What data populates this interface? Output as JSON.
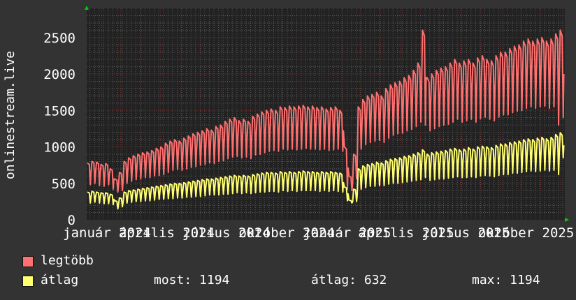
{
  "chart_data": {
    "type": "line",
    "ylabel": "onlinestream.live",
    "xlabel": "",
    "ylim": [
      0,
      2900
    ],
    "xlim": [
      "2024-01-09",
      "2026-01-07"
    ],
    "yticks": [
      "0",
      "500",
      "1000",
      "1500",
      "2000",
      "2500"
    ],
    "ytick_values": [
      0,
      500,
      1000,
      1500,
      2000,
      2500
    ],
    "xticks": [
      "január 2024",
      "április 2024",
      "július 2024",
      "október 2024",
      "január 2025",
      "április 2025",
      "július 2025",
      "október 2025"
    ],
    "grid": true,
    "resolution": "weekly high and low",
    "background": "#222222",
    "series": [
      {
        "name": "legtöbb",
        "color": "#ff7070",
        "weekly_high": [
          780,
          800,
          790,
          760,
          770,
          700,
          560,
          650,
          800,
          850,
          880,
          900,
          920,
          930,
          950,
          980,
          1000,
          1050,
          1080,
          1100,
          1080,
          1120,
          1150,
          1180,
          1200,
          1220,
          1250,
          1230,
          1280,
          1300,
          1350,
          1380,
          1400,
          1360,
          1380,
          1350,
          1420,
          1450,
          1480,
          1500,
          1520,
          1500,
          1550,
          1540,
          1560,
          1550,
          1560,
          1570,
          1550,
          1560,
          1540,
          1550,
          1520,
          1540,
          1550,
          1500,
          1000,
          600,
          900,
          1550,
          1650,
          1700,
          1720,
          1750,
          1700,
          1800,
          1850,
          1880,
          1900,
          1950,
          1980,
          2050,
          2150,
          2600,
          1950,
          2000,
          2050,
          2080,
          2100,
          2150,
          2200,
          2150,
          2180,
          2200,
          2150,
          2220,
          2250,
          2200,
          2180,
          2250,
          2300,
          2300,
          2350,
          2380,
          2400,
          2450,
          2480,
          2450,
          2480,
          2500,
          2450,
          2480,
          2550,
          2600
        ],
        "weekly_low": [
          480,
          500,
          470,
          460,
          480,
          420,
          380,
          400,
          500,
          530,
          550,
          560,
          580,
          580,
          600,
          610,
          620,
          650,
          680,
          690,
          680,
          700,
          720,
          730,
          750,
          760,
          780,
          770,
          800,
          810,
          840,
          860,
          870,
          850,
          860,
          840,
          890,
          900,
          920,
          940,
          950,
          940,
          970,
          960,
          970,
          960,
          970,
          980,
          970,
          970,
          960,
          970,
          950,
          960,
          970,
          940,
          420,
          400,
          560,
          970,
          1030,
          1060,
          1080,
          1090,
          1060,
          1120,
          1160,
          1180,
          1190,
          1220,
          1240,
          1280,
          1340,
          1300,
          1220,
          1250,
          1280,
          1300,
          1310,
          1340,
          1380,
          1340,
          1360,
          1380,
          1340,
          1390,
          1410,
          1380,
          1360,
          1410,
          1440,
          1440,
          1470,
          1490,
          1500,
          1530,
          1550,
          1530,
          1550,
          1560,
          1530,
          1550,
          1300,
          1400
        ]
      },
      {
        "name": "átlag",
        "color": "#ffff70",
        "weekly_high": [
          380,
          390,
          380,
          370,
          370,
          350,
          260,
          300,
          380,
          400,
          410,
          420,
          430,
          440,
          450,
          460,
          470,
          480,
          490,
          500,
          500,
          510,
          520,
          530,
          540,
          550,
          560,
          560,
          570,
          580,
          590,
          600,
          610,
          600,
          610,
          600,
          620,
          630,
          640,
          650,
          650,
          640,
          660,
          650,
          660,
          650,
          660,
          670,
          660,
          660,
          650,
          660,
          650,
          660,
          650,
          640,
          450,
          270,
          420,
          700,
          740,
          760,
          770,
          790,
          780,
          810,
          830,
          840,
          850,
          870,
          880,
          900,
          920,
          960,
          900,
          920,
          930,
          940,
          950,
          970,
          980,
          960,
          970,
          990,
          970,
          1000,
          1010,
          1000,
          990,
          1020,
          1040,
          1040,
          1060,
          1070,
          1080,
          1100,
          1110,
          1100,
          1120,
          1130,
          1110,
          1130,
          1170,
          1194
        ],
        "weekly_low": [
          230,
          240,
          230,
          220,
          220,
          210,
          150,
          180,
          230,
          240,
          250,
          250,
          260,
          260,
          270,
          280,
          280,
          290,
          290,
          300,
          300,
          310,
          310,
          320,
          320,
          330,
          340,
          340,
          340,
          350,
          350,
          360,
          370,
          360,
          370,
          360,
          370,
          380,
          380,
          390,
          390,
          380,
          400,
          390,
          400,
          390,
          400,
          400,
          400,
          400,
          390,
          400,
          390,
          400,
          390,
          380,
          260,
          230,
          250,
          420,
          440,
          460,
          460,
          470,
          470,
          490,
          500,
          500,
          510,
          520,
          530,
          540,
          550,
          580,
          540,
          550,
          560,
          560,
          570,
          580,
          590,
          580,
          580,
          590,
          580,
          600,
          610,
          600,
          590,
          610,
          620,
          620,
          640,
          640,
          650,
          660,
          670,
          660,
          670,
          680,
          670,
          680,
          620,
          850
        ]
      }
    ]
  },
  "legend": {
    "items": [
      {
        "label": "legtöbb",
        "color": "#ff7070"
      },
      {
        "label": "átlag",
        "color": "#ffff70"
      }
    ],
    "stats": {
      "now": "most: 1194",
      "avg": "átlag: 632",
      "max": "max: 1194"
    }
  },
  "colors": {
    "page_bg": "#333333",
    "plot_bg": "#222222",
    "minor_grid": "#5a5a5a",
    "major_grid": "#7a3535",
    "arrow": "#00cc00"
  }
}
